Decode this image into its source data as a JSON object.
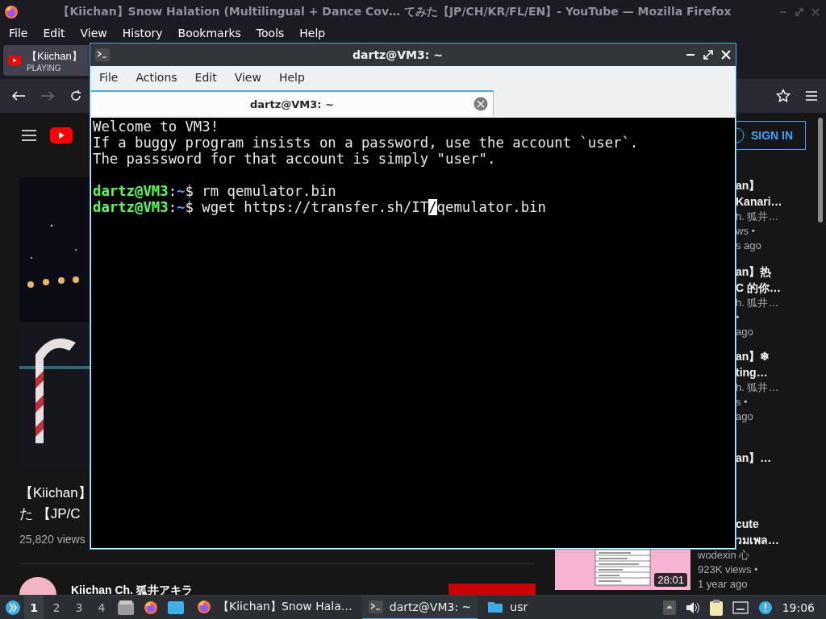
{
  "firefox": {
    "title": "【Kiichan】Snow Halation (Multilingual + Dance Cov…   てみた【JP/CH/KR/FL/EN】- YouTube — Mozilla Firefox",
    "menu": [
      "File",
      "Edit",
      "View",
      "History",
      "Bookmarks",
      "Tools",
      "Help"
    ],
    "tab": {
      "title": "【Kiichan】",
      "status": "PLAYING"
    }
  },
  "youtube": {
    "sign_in": "SIGN IN",
    "video": {
      "kind": "picture",
      "title_lines": [
        "【Kiichan】",
        "た 【JP/C"
      ],
      "views": "25,820 views",
      "channel": "Kiichan Ch. 狐井アキラ"
    },
    "related": [
      {
        "title_lines": [
          "an】",
          "Kanari…"
        ],
        "channel": "h. 狐井…",
        "views": "ws •",
        "age": "s ago"
      },
      {
        "title_lines": [
          "an】热",
          "C 的你…"
        ],
        "channel": "h. 狐井…",
        "views": "•",
        "age": "ago"
      },
      {
        "title_lines": [
          "an】❄",
          "ting…"
        ],
        "channel": "h. 狐井…",
        "views": "s •",
        "age": "ago"
      },
      {
        "title_lines": [
          "an】…"
        ]
      },
      {
        "title_lines": [
          "cute",
          "วมเพล…"
        ],
        "channel": "wodexin 心",
        "views": "923K views •",
        "age": "1 year ago",
        "thumbnail": {
          "kind": "picture",
          "duration": "28:01"
        }
      }
    ]
  },
  "terminal": {
    "title": "dartz@VM3: ~",
    "menu": [
      "File",
      "Actions",
      "Edit",
      "View",
      "Help"
    ],
    "tab": {
      "title": "dartz@VM3: ~"
    },
    "lines": [
      {
        "kind": "text",
        "text": "Welcome to VM3!"
      },
      {
        "kind": "text",
        "text": "If a buggy program insists on a password, use the account `user`."
      },
      {
        "kind": "text",
        "text": "The passsword for that account is simply \"user\"."
      },
      {
        "kind": "blank"
      },
      {
        "kind": "prompt",
        "user": "dartz@VM3",
        "separator": ":",
        "path": "~",
        "sign": "$",
        "command": "rm qemulator.bin"
      },
      {
        "kind": "prompt",
        "user": "dartz@VM3",
        "separator": ":",
        "path": "~",
        "sign": "$",
        "command": "wget https://transfer.sh/IT",
        "cursor": "/",
        "command_rest": "qemulator.bin"
      }
    ]
  },
  "taskbar": {
    "workspaces": [
      {
        "label": "1",
        "selected": true
      },
      {
        "label": "2",
        "selected": false
      },
      {
        "label": "3",
        "selected": false
      },
      {
        "label": "4",
        "selected": false
      }
    ],
    "tasks": [
      {
        "kind": "browser",
        "label": "【Kiichan】Snow Hala…",
        "selected": false
      },
      {
        "kind": "terminal",
        "label": "dartz@VM3: ~",
        "selected": true
      },
      {
        "kind": "folder",
        "label": "usr",
        "selected": false
      }
    ],
    "clock": "19:06"
  }
}
